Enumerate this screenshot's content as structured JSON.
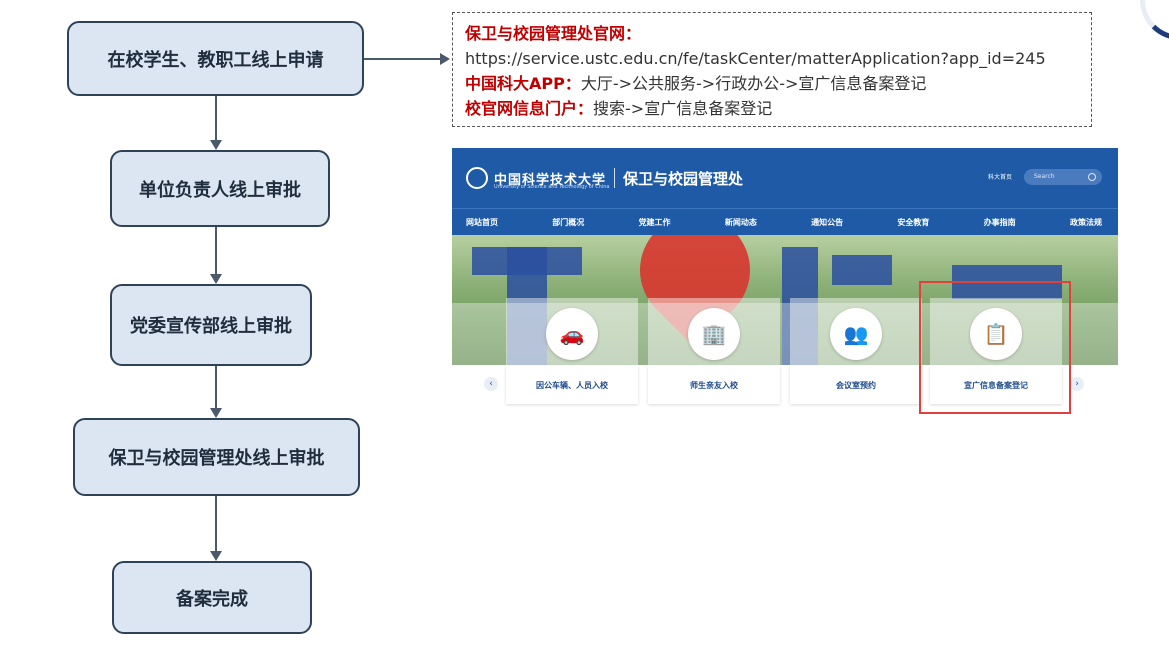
{
  "flow": {
    "step1": "在校学生、教职工线上申请",
    "step2": "单位负责人线上审批",
    "step3": "党委宣传部线上审批",
    "step4": "保卫与校园管理处线上审批",
    "step5": "备案完成"
  },
  "note": {
    "line1_label": "保卫与校园管理处官网：",
    "line2_url": "https://service.ustc.edu.cn/fe/taskCenter/matterApplication?app_id=245",
    "line3_label": "中国科大APP：",
    "line3_path": "大厅->公共服务->行政办公->宣广信息备案登记",
    "line4_label": "校官网信息门户：",
    "line4_path": "搜索->宣广信息备案登记"
  },
  "site": {
    "logo_text": "中国科学技术大学",
    "logo_sub": "University of Science and Technology of China",
    "dept": "保卫与校园管理处",
    "top_link": "科大首页",
    "search_placeholder": "Search",
    "nav": [
      "网站首页",
      "部门概况",
      "党建工作",
      "新闻动态",
      "通知公告",
      "安全教育",
      "办事指南",
      "政策法规"
    ],
    "cards": [
      {
        "label": "因公车辆、人员入校",
        "icon": "car-person-icon"
      },
      {
        "label": "师生亲友入校",
        "icon": "building-icon"
      },
      {
        "label": "会议室预约",
        "icon": "meeting-icon"
      },
      {
        "label": "宣广信息备案登记",
        "icon": "clipboard-edit-icon"
      }
    ],
    "prev": "‹",
    "next": "›"
  },
  "colors": {
    "box_fill": "#dce6f2",
    "box_border": "#2f4358",
    "accent_red": "#c00000",
    "site_blue": "#1e5aa6",
    "highlight": "#e0413d"
  }
}
